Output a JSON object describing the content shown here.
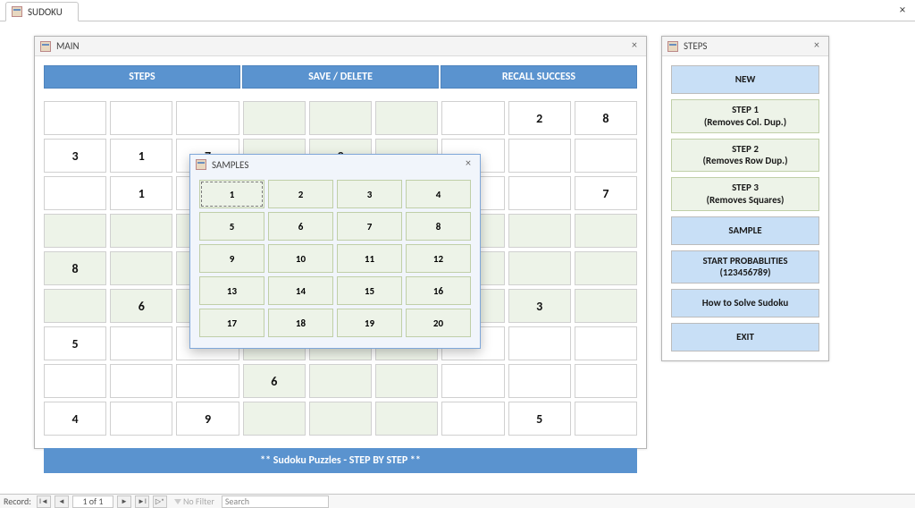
{
  "app": {
    "tab_label": "SUDOKU"
  },
  "main": {
    "title": "MAIN",
    "hdr": {
      "steps": "STEPS",
      "savedel": "SAVE / DELETE",
      "recall": "RECALL SUCCESS"
    },
    "footer": "** Sudoku Puzzles - STEP BY STEP **",
    "cells": [
      "",
      "",
      "",
      "",
      "",
      "",
      "",
      "2",
      "8",
      "3",
      "1",
      "7",
      "",
      "9",
      "",
      "",
      "",
      "",
      "",
      "1",
      "",
      "",
      "",
      "",
      "",
      "",
      "7",
      "",
      "",
      "",
      "",
      "",
      "",
      "",
      "",
      "",
      "8",
      "",
      "",
      "",
      "",
      "",
      "",
      "",
      "",
      "",
      "6",
      "",
      "",
      "",
      "",
      "",
      "3",
      "",
      "5",
      "",
      "",
      "",
      "",
      "",
      "",
      "",
      "",
      "",
      "",
      "",
      "6",
      "",
      "",
      "",
      "",
      "",
      "4",
      "",
      "9",
      "",
      "",
      "",
      "",
      "5",
      ""
    ]
  },
  "steps": {
    "title": "STEPS",
    "new": "NEW",
    "s1a": "STEP 1",
    "s1b": "(Removes Col. Dup.)",
    "s2a": "STEP 2",
    "s2b": "(Removes Row Dup.)",
    "s3a": "STEP 3",
    "s3b": "(Removes Squares)",
    "sample": "SAMPLE",
    "startA": "START PROBABLITIES",
    "startB": "(123456789)",
    "howto": "How to Solve Sudoku",
    "exit": "EXIT"
  },
  "samples": {
    "title": "SAMPLES",
    "items": [
      "1",
      "2",
      "3",
      "4",
      "5",
      "6",
      "7",
      "8",
      "9",
      "10",
      "11",
      "12",
      "13",
      "14",
      "15",
      "16",
      "17",
      "18",
      "19",
      "20"
    ]
  },
  "status": {
    "record_label": "Record:",
    "pos": "1 of 1",
    "no_filter": "No Filter",
    "search_placeholder": "Search"
  }
}
